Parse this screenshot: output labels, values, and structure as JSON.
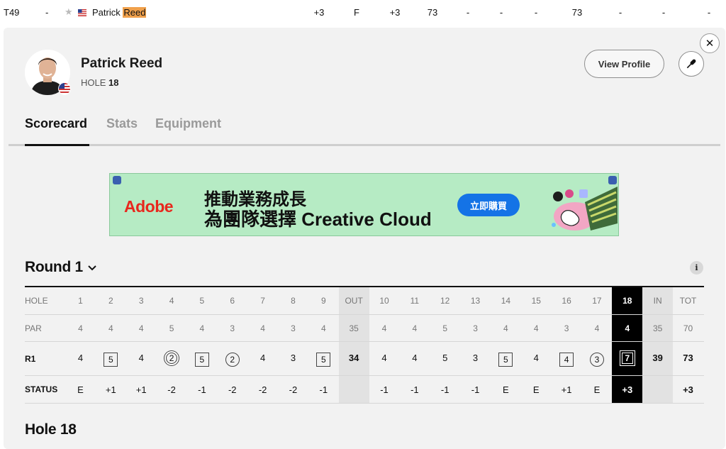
{
  "leaderboard_row": {
    "position": "T49",
    "movement": "-",
    "player_first": "Patrick",
    "player_last": "Reed",
    "to_par": "+3",
    "thru": "F",
    "today": "+3",
    "r1": "73",
    "r2": "-",
    "r3": "-",
    "r4": "-",
    "total": "73",
    "extra": [
      "-",
      "-",
      "-"
    ],
    "accent_color": "#f0a04b"
  },
  "player": {
    "name": "Patrick Reed",
    "hole_prefix": "HOLE",
    "hole_number": "18",
    "view_profile_label": "View Profile"
  },
  "tabs": [
    {
      "label": "Scorecard",
      "active": true
    },
    {
      "label": "Stats",
      "active": false
    },
    {
      "label": "Equipment",
      "active": false
    }
  ],
  "ad": {
    "brand": "Adobe",
    "line1": "推動業務成長",
    "line2": "為團隊選擇 Creative Cloud",
    "cta": "立即購買",
    "background": "#b6ebc4"
  },
  "round": {
    "title": "Round 1",
    "info_icon_text": "i"
  },
  "scorecard": {
    "row_labels": {
      "hole": "HOLE",
      "par": "PAR",
      "r1": "R1",
      "status": "STATUS"
    },
    "holes": [
      "1",
      "2",
      "3",
      "4",
      "5",
      "6",
      "7",
      "8",
      "9",
      "OUT",
      "10",
      "11",
      "12",
      "13",
      "14",
      "15",
      "16",
      "17",
      "18",
      "IN",
      "TOT"
    ],
    "par": [
      "4",
      "4",
      "4",
      "5",
      "4",
      "3",
      "4",
      "3",
      "4",
      "35",
      "4",
      "4",
      "5",
      "3",
      "4",
      "4",
      "3",
      "4",
      "4",
      "35",
      "70"
    ],
    "r1": [
      "4",
      "5",
      "4",
      "2",
      "5",
      "2",
      "4",
      "3",
      "5",
      "34",
      "4",
      "4",
      "5",
      "3",
      "5",
      "4",
      "4",
      "3",
      "7",
      "39",
      "73"
    ],
    "r1_marks": [
      "none",
      "box",
      "none",
      "double-circle",
      "box",
      "circle",
      "none",
      "none",
      "box",
      "none",
      "none",
      "none",
      "none",
      "none",
      "box",
      "none",
      "box",
      "circle",
      "double-box",
      "none",
      "none"
    ],
    "status": [
      "E",
      "+1",
      "+1",
      "-2",
      "-1",
      "-2",
      "-2",
      "-2",
      "-1",
      "",
      "-1",
      "-1",
      "-1",
      "-1",
      "E",
      "E",
      "+1",
      "E",
      "+3",
      "",
      "+3"
    ]
  },
  "hole_section_title": "Hole 18"
}
